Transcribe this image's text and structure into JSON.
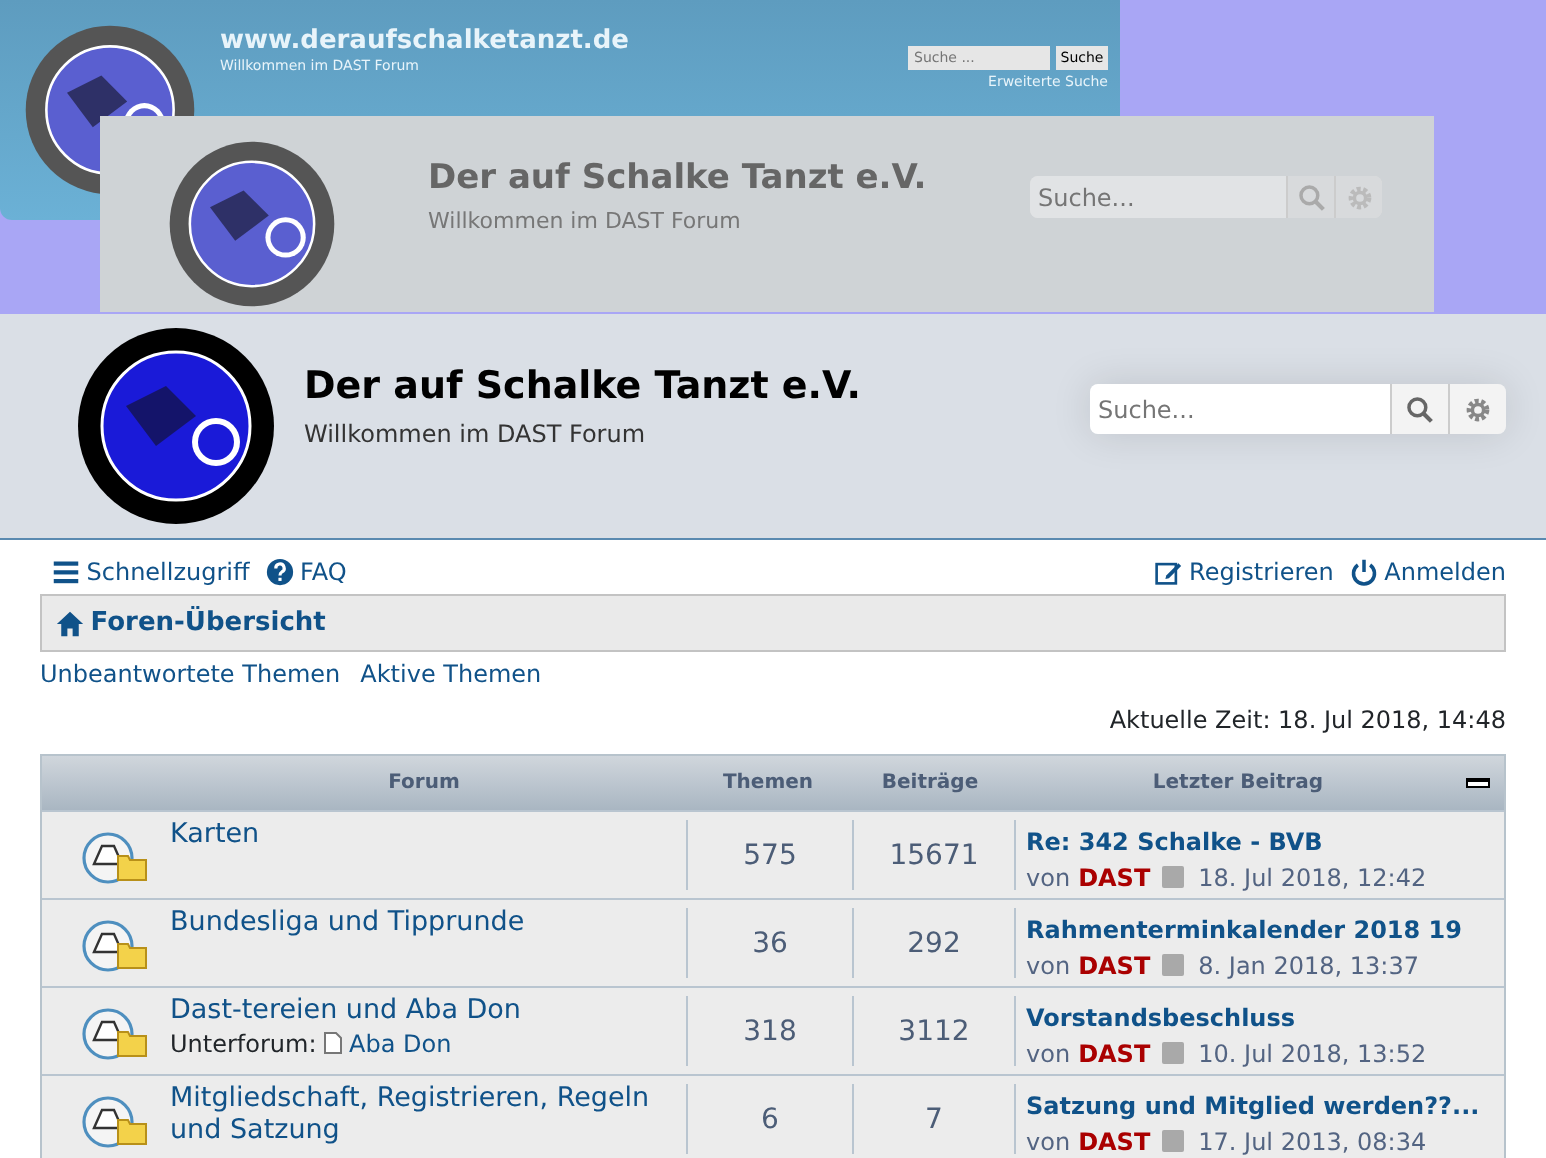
{
  "previews": [
    {
      "kind": "classic",
      "site_title": "www.deraufschalketanzt.de",
      "site_description": "Willkommen im DAST Forum",
      "search_placeholder": "Suche ...",
      "search_button": "Suche",
      "advanced_search": "Erweiterte Suche"
    },
    {
      "kind": "faded",
      "site_title": "Der auf Schalke Tanzt e.V.",
      "site_description": "Willkommen im DAST Forum",
      "search_placeholder": "Suche..."
    }
  ],
  "header": {
    "site_title": "Der auf Schalke Tanzt e.V.",
    "site_description": "Willkommen im DAST Forum",
    "search_placeholder": "Suche..."
  },
  "navbar": {
    "left": [
      {
        "kind": "menu",
        "label": "Schnellzugriff"
      },
      {
        "kind": "help",
        "label": "FAQ"
      }
    ],
    "right": [
      {
        "kind": "edit",
        "label": "Registrieren"
      },
      {
        "kind": "power",
        "label": "Anmelden"
      }
    ]
  },
  "breadcrumb": "Foren-Übersicht",
  "quick_links": [
    "Unbeantwortete Themen",
    "Aktive Themen"
  ],
  "current_time": "Aktuelle Zeit: 18. Jul 2018, 14:48",
  "table": {
    "columns": [
      "Forum",
      "Themen",
      "Beiträge",
      "Letzter Beitrag"
    ],
    "rows": [
      {
        "title": "Karten",
        "topics": "575",
        "posts": "15671",
        "last_title": "Re: 342 Schalke - BVB",
        "by": "von",
        "author": "DAST",
        "date": "18. Jul 2018, 12:42"
      },
      {
        "title": "Bundesliga und Tipprunde",
        "topics": "36",
        "posts": "292",
        "last_title": "Rahmenterminkalender 2018 19",
        "by": "von",
        "author": "DAST",
        "date": "8. Jan 2018, 13:37"
      },
      {
        "title": "Dast-tereien und Aba Don",
        "subforum_label": "Unterforum:",
        "subforum": "Aba Don",
        "topics": "318",
        "posts": "3112",
        "last_title": "Vorstandsbeschluss",
        "by": "von",
        "author": "DAST",
        "date": "10. Jul 2018, 13:52"
      },
      {
        "title": "Mitgliedschaft, Registrieren, Regeln und Satzung",
        "topics": "6",
        "posts": "7",
        "last_title": "Satzung und Mitglied werden??...",
        "by": "von",
        "author": "DAST",
        "date": "17. Jul 2013, 08:34"
      }
    ]
  }
}
